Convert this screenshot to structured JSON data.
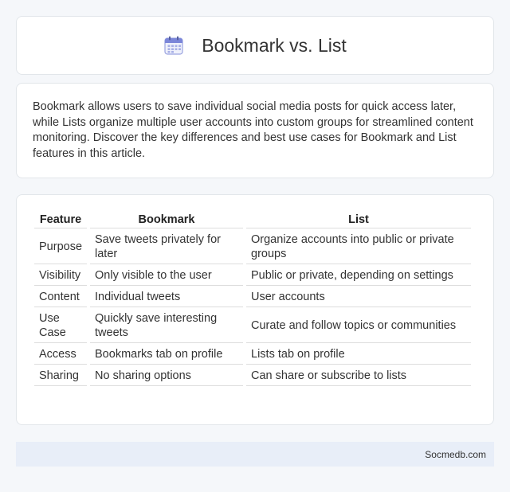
{
  "header": {
    "title": "Bookmark vs. List",
    "icon": "calendar-icon"
  },
  "intro": {
    "text": "Bookmark allows users to save individual social media posts for quick access later, while Lists organize multiple user accounts into custom groups for streamlined content monitoring. Discover the key differences and best use cases for Bookmark and List features in this article."
  },
  "table": {
    "headers": [
      "Feature",
      "Bookmark",
      "List"
    ],
    "rows": [
      [
        "Purpose",
        "Save tweets privately for later",
        "Organize accounts into public or private groups"
      ],
      [
        "Visibility",
        "Only visible to the user",
        "Public or private, depending on settings"
      ],
      [
        "Content",
        "Individual tweets",
        "User accounts"
      ],
      [
        "Use Case",
        "Quickly save interesting tweets",
        "Curate and follow topics or communities"
      ],
      [
        "Access",
        "Bookmarks tab on profile",
        "Lists tab on profile"
      ],
      [
        "Sharing",
        "No sharing options",
        "Can share or subscribe to lists"
      ]
    ]
  },
  "footer": {
    "site": "Socmedb.com"
  }
}
